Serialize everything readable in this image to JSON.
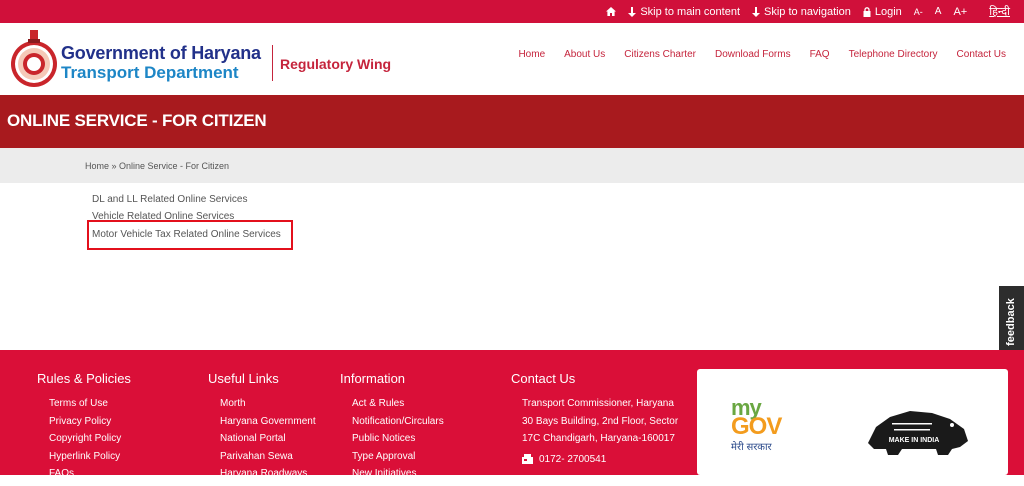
{
  "topbar": {
    "skip_main": "Skip to main content",
    "skip_nav": "Skip to navigation",
    "login": "Login",
    "font_decrease": "A-",
    "font_normal": "A",
    "font_increase": "A+",
    "hindi": "हिन्दी"
  },
  "header": {
    "org_line1": "Government of Haryana",
    "org_line2": "Transport Department",
    "wing": "Regulatory Wing"
  },
  "nav": {
    "items": [
      "Home",
      "About Us",
      "Citizens Charter",
      "Download Forms",
      "FAQ",
      "Telephone Directory",
      "Contact Us"
    ]
  },
  "banner": {
    "title": "ONLINE SERVICE - FOR CITIZEN"
  },
  "breadcrumb": {
    "text": "Home » Online Service - For Citizen"
  },
  "services": [
    "DL and LL Related Online Services",
    "Vehicle Related Online Services",
    "Motor Vehicle Tax Related Online Services"
  ],
  "feedback": {
    "label": "feedback"
  },
  "footer": {
    "rules": {
      "title": "Rules & Policies",
      "items": [
        "Terms of Use",
        "Privacy Policy",
        "Copyright Policy",
        "Hyperlink Policy",
        "FAQs"
      ]
    },
    "useful": {
      "title": "Useful Links",
      "items": [
        "Morth",
        "Haryana Government",
        "National Portal",
        "Parivahan Sewa",
        "Haryana Roadways"
      ]
    },
    "info": {
      "title": "Information",
      "items": [
        "Act & Rules",
        "Notification/Circulars",
        "Public Notices",
        "Type Approval",
        "New Initiatives"
      ]
    },
    "contact": {
      "title": "Contact Us",
      "line1": "Transport Commissioner, Haryana",
      "line2": "30 Bays Building, 2nd Floor, Sector",
      "line3": "17C Chandigarh, Haryana-160017",
      "phone": "0172- 2700541"
    },
    "mygov": {
      "my": "my",
      "gov": "GOV",
      "tagline": "मेरी सरकार"
    },
    "make_in_india": "MAKE IN INDIA"
  },
  "colors": {
    "topbar": "#d0103a",
    "banner": "#a81a1e",
    "footer": "#da0f38",
    "nav_link": "#c5243c",
    "highlight": "#e3101c"
  }
}
